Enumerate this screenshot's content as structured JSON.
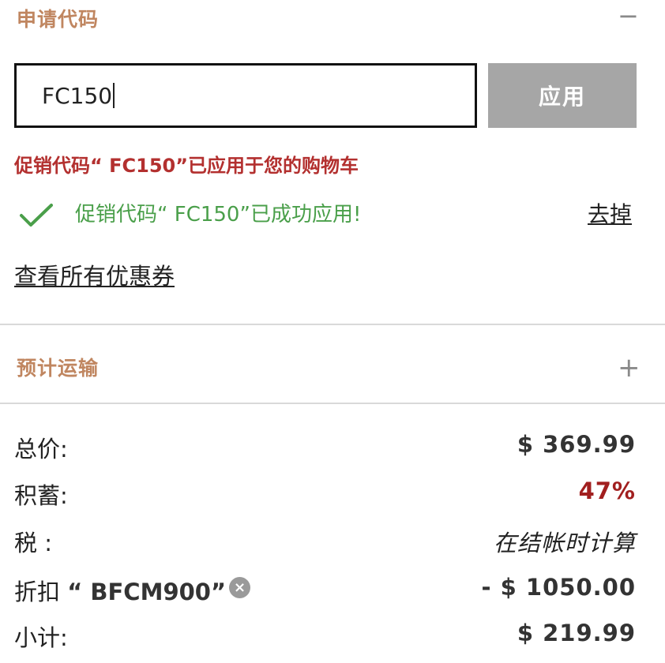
{
  "promo_section": {
    "title": "申请代码",
    "toggle": "−",
    "input_value": "FC150",
    "apply_label": "应用",
    "error_message": "促销代码“ FC150”已应用于您的购物车",
    "success_message": "促销代码“ FC150”已成功应用!",
    "remove_label": "去掉",
    "view_coupons_label": "查看所有优惠券"
  },
  "shipping_section": {
    "title": "预计运输",
    "toggle": "+"
  },
  "summary": {
    "total_label": "总价:",
    "total_value": "$ 369.99",
    "savings_label": "积蓄:",
    "savings_value": "47%",
    "tax_label": "税 :",
    "tax_value": "在结帐时计算",
    "discount_label": "折扣",
    "discount_code": "“ BFCM900”",
    "discount_remove_icon": "×",
    "discount_value": "- $ 1050.00",
    "subtotal_label": "小计:",
    "subtotal_value": "$ 219.99"
  },
  "colors": {
    "section_title": "#c08660",
    "error": "#b3302f",
    "success": "#4a9f4a",
    "savings": "#a11f1f",
    "button_bg": "#a6a6a6"
  },
  "icons": {
    "check": "check-icon",
    "collapse": "minus-icon",
    "expand": "plus-icon",
    "remove": "close-circle-icon"
  }
}
